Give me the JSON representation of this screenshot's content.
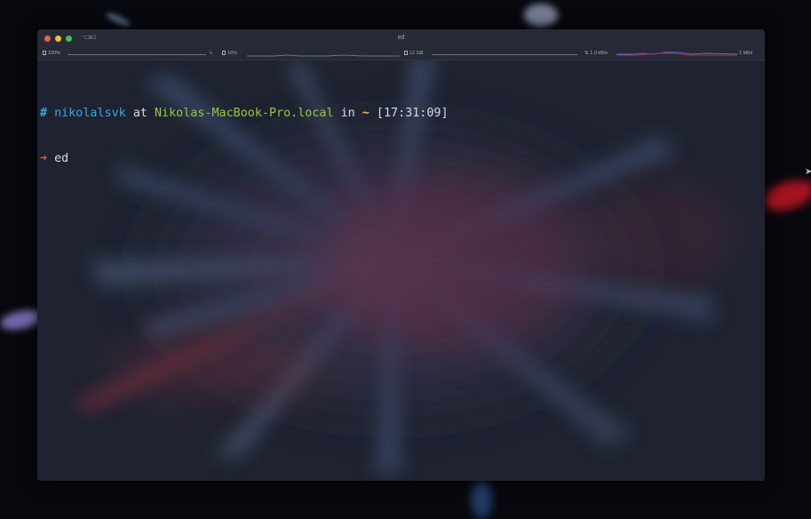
{
  "window": {
    "title": "ed",
    "shortcut": "⌥⌘2"
  },
  "status_bar": {
    "battery": "100%",
    "battery_charging_icon": "bolt-icon",
    "cpu": "16%",
    "memory": "12 GB",
    "network_down": "1.0 kB/s",
    "network_up": "1 kB/s"
  },
  "terminal": {
    "prompt_symbol": "#",
    "user": "nikolalsvk",
    "at_word": "at",
    "host": "Nikolas-MacBook-Pro.local",
    "in_word": "in",
    "directory": "~",
    "time": "[17:31:09]",
    "command_arrow": "➜",
    "command": "ed"
  },
  "colors": {
    "user": "#33a9e6",
    "host": "#98c93a",
    "directory": "#e8c343",
    "arrow": "#e8544a",
    "window_bg": "#1f2331"
  }
}
